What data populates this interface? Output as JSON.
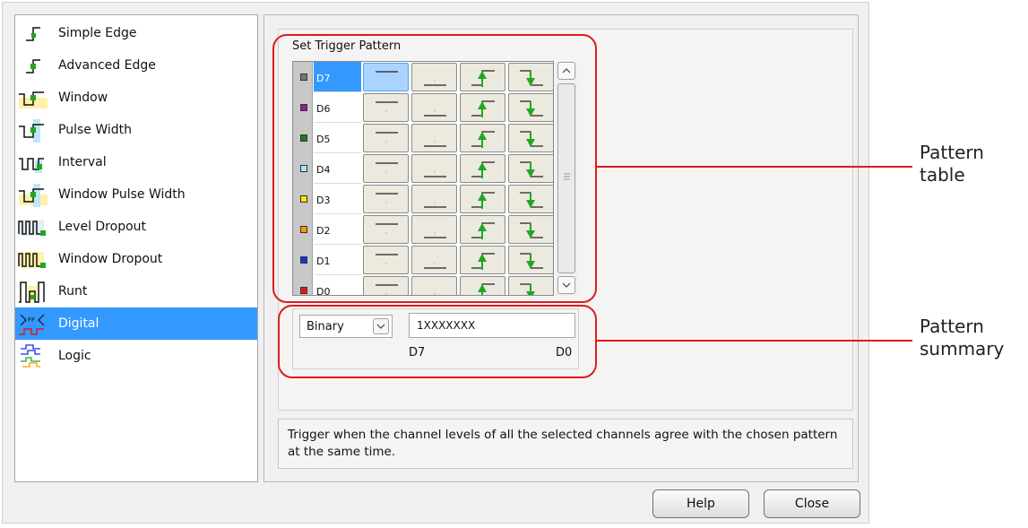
{
  "trigger_types": [
    {
      "label": "Simple Edge",
      "icon": "simple-edge-icon"
    },
    {
      "label": "Advanced Edge",
      "icon": "advanced-edge-icon"
    },
    {
      "label": "Window",
      "icon": "window-trigger-icon"
    },
    {
      "label": "Pulse Width",
      "icon": "pulse-width-icon"
    },
    {
      "label": "Interval",
      "icon": "interval-icon"
    },
    {
      "label": "Window Pulse Width",
      "icon": "window-pulse-width-icon"
    },
    {
      "label": "Level Dropout",
      "icon": "level-dropout-icon"
    },
    {
      "label": "Window Dropout",
      "icon": "window-dropout-icon"
    },
    {
      "label": "Runt",
      "icon": "runt-icon"
    },
    {
      "label": "Digital",
      "icon": "digital-icon",
      "selected": true
    },
    {
      "label": "Logic",
      "icon": "logic-icon"
    }
  ],
  "pattern": {
    "title": "Set Trigger Pattern",
    "channels": [
      {
        "name": "D7",
        "color": "#777777",
        "selected_state": "high"
      },
      {
        "name": "D6",
        "color": "#9a1a9a",
        "selected_state": null
      },
      {
        "name": "D5",
        "color": "#1e7a1e",
        "selected_state": null
      },
      {
        "name": "D4",
        "color": "#aee0ff",
        "selected_state": null
      },
      {
        "name": "D3",
        "color": "#f5e600",
        "selected_state": null
      },
      {
        "name": "D2",
        "color": "#ff9900",
        "selected_state": null
      },
      {
        "name": "D1",
        "color": "#1a2ee0",
        "selected_state": null
      },
      {
        "name": "D0",
        "color": "#d91c1c",
        "selected_state": null
      }
    ],
    "states": [
      "high",
      "low",
      "rising",
      "falling"
    ]
  },
  "summary": {
    "format": "Binary",
    "value": "1XXXXXXX",
    "msb_label": "D7",
    "lsb_label": "D0"
  },
  "description": "Trigger when the channel levels of all the selected channels agree with the chosen pattern at the same time.",
  "buttons": {
    "help": "Help",
    "close": "Close"
  },
  "annotations": {
    "table_label_line1": "Pattern",
    "table_label_line2": "table",
    "summary_label_line1": "Pattern",
    "summary_label_line2": "summary"
  },
  "colors": {
    "highlight": "#e01b1b",
    "selection": "#3399ff",
    "edge_arrow": "#1fa81f"
  }
}
